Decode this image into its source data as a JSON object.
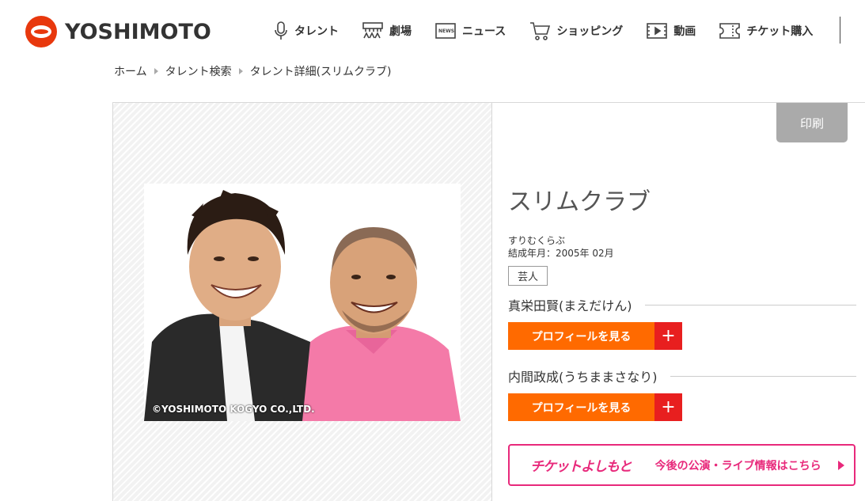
{
  "brand": {
    "name": "YOSHIMOTO",
    "color": "#e8380d"
  },
  "nav": [
    {
      "label": "タレント",
      "icon": "microphone-icon"
    },
    {
      "label": "劇場",
      "icon": "theater-icon"
    },
    {
      "label": "ニュース",
      "icon": "news-icon"
    },
    {
      "label": "ショッピング",
      "icon": "cart-icon"
    },
    {
      "label": "動画",
      "icon": "video-icon"
    },
    {
      "label": "チケット購入",
      "icon": "ticket-icon"
    }
  ],
  "breadcrumb": [
    "ホーム",
    "タレント検索",
    "タレント詳細(スリムクラブ)"
  ],
  "print_label": "印刷",
  "photo_credit": "©YOSHIMOTO KOGYO CO.,LTD.",
  "talent": {
    "name": "スリムクラブ",
    "kana": "すりむくらぶ",
    "formed": "結成年月：2005年 02月",
    "tag": "芸人"
  },
  "members": [
    {
      "name": "真栄田賢(まえだけん)",
      "button": "プロフィールを見る",
      "plus": "+"
    },
    {
      "name": "内間政成(うちままさなり)",
      "button": "プロフィールを見る",
      "plus": "+"
    }
  ],
  "ticket_banner": {
    "logo": "チケットよしもと",
    "text": "今後の公演・ライブ情報はこちら"
  },
  "colors": {
    "orange": "#ff6a00",
    "red": "#e81f1f",
    "pink": "#e8297b",
    "print_gray": "#aaaaaa"
  }
}
